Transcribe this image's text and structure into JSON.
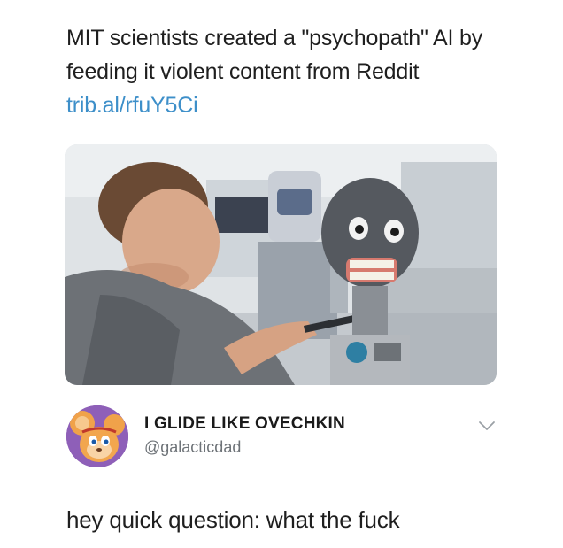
{
  "post": {
    "headline": "MIT scientists created a \"psychopath\" AI by feeding it violent content from Reddit",
    "link": "trib.al/rfuY5Ci"
  },
  "media": {
    "icon": "photo-man-working-on-robot-head"
  },
  "reply": {
    "display_name": "I GLIDE LIKE OVECHKIN",
    "handle": "@galacticdad",
    "text": "hey quick question: what the fuck",
    "avatar_icon": "cartoon-mouse-avatar-icon",
    "menu_icon": "chevron-down-icon"
  },
  "colors": {
    "link": "#3d8fc9",
    "handle": "#6e7378",
    "text": "#1f1f1f"
  }
}
